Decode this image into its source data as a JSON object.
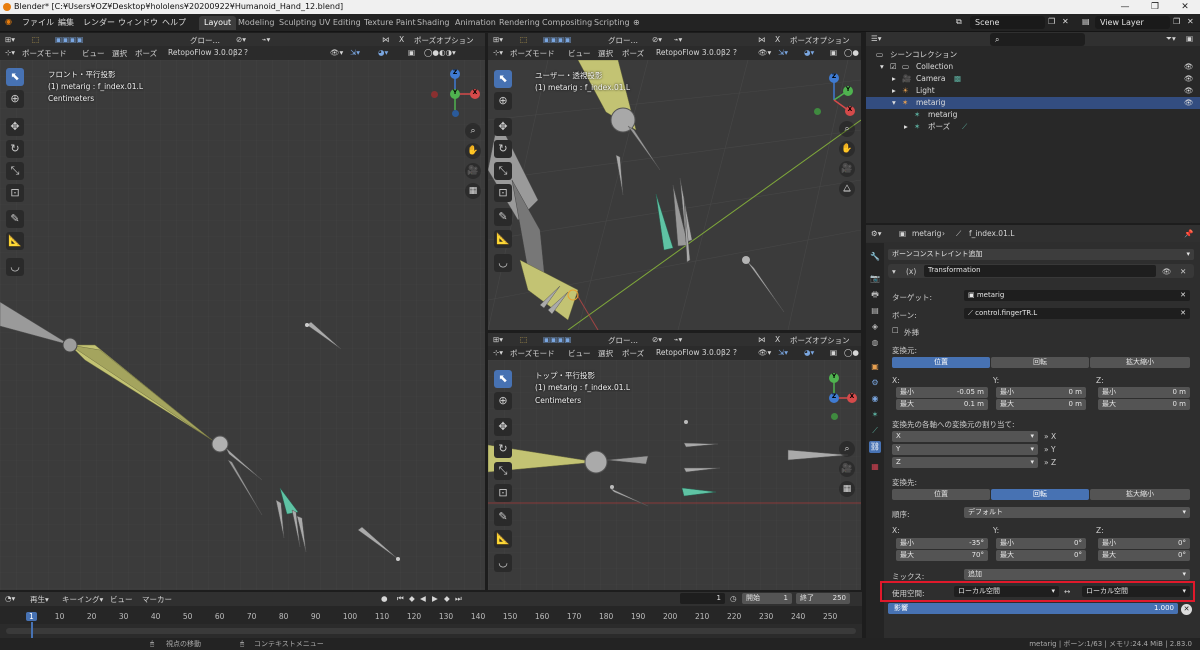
{
  "window": {
    "title": "Blender* [C:¥Users¥OZ¥Desktop¥hololens¥20200922¥Humanoid_Hand_12.blend]"
  },
  "menu": [
    "ファイル",
    "編集",
    "レンダー",
    "ウィンドウ",
    "ヘルプ"
  ],
  "workspaces": [
    "Layout",
    "Modeling",
    "Sculpting",
    "UV Editing",
    "Texture Paint",
    "Shading",
    "Animation",
    "Rendering",
    "Compositing",
    "Scripting"
  ],
  "active_workspace": "Layout",
  "scene_name": "Scene",
  "view_layer": "View Layer",
  "viewport_header": {
    "mode": "ポーズモード",
    "view": "ビュー",
    "select": "選択",
    "pose": "ポーズ",
    "addon": "RetopoFlow 3.0.0β2",
    "pose_options": "ポーズオプション",
    "orientation": "グロー…",
    "x_mirror": "X"
  },
  "viewports": {
    "front": {
      "view_name": "フロント・平行投影",
      "object": "(1) metarig : f_index.01.L",
      "units": "Centimeters"
    },
    "user": {
      "view_name": "ユーザー・透視投影",
      "object": "(1) metarig : f_index.01.L"
    },
    "top": {
      "view_name": "トップ・平行投影",
      "object": "(1) metarig : f_index.01.L",
      "units": "Centimeters"
    }
  },
  "outliner": {
    "header": "シーンコレクション",
    "rows": [
      "Collection",
      "Camera",
      "Light",
      "metarig",
      "metarig",
      "ポーズ"
    ],
    "search_placeholder": ""
  },
  "properties": {
    "breadcrumb_object": "metarig",
    "breadcrumb_bone": "f_index.01.L",
    "add_constraint": "ボーンコンストレイント追加",
    "constraint_name": "Transformation",
    "target_label": "ターゲット:",
    "target_value": "metarig",
    "bone_label": "ボーン:",
    "bone_value": "control.fingerTR.L",
    "extrapolate_label": "外挿",
    "map_from_label": "変換元:",
    "map_from_tabs": [
      "位置",
      "回転",
      "拡大縮小"
    ],
    "axis_x": "X:",
    "axis_y": "Y:",
    "axis_z": "Z:",
    "min_label": "最小",
    "max_label": "最大",
    "from_x_min": "-0.05 m",
    "from_x_max": "0.1 m",
    "from_y_min": "0 m",
    "from_y_max": "0 m",
    "from_z_min": "0 m",
    "from_z_max": "0 m",
    "mapping_label": "変換先の各軸への変換元の割り当て:",
    "mapping_rows": [
      {
        "source": "X",
        "target": "X"
      },
      {
        "source": "Y",
        "target": "Y"
      },
      {
        "source": "Z",
        "target": "Z"
      }
    ],
    "map_to_label": "変換先:",
    "map_to_tabs": [
      "位置",
      "回転",
      "拡大縮小"
    ],
    "order_label": "順序:",
    "order_value": "デフォルト",
    "to_x_min": "-35°",
    "to_x_max": "70°",
    "to_y_min": "0°",
    "to_y_max": "0°",
    "to_z_min": "0°",
    "to_z_max": "0°",
    "mix_label": "ミックス:",
    "mix_value": "追加",
    "space_label": "使用空間:",
    "owner_space": "ローカル空間",
    "target_space": "ローカル空間",
    "influence_label": "影響",
    "influence_value": "1.000",
    "influence_fraction": 1.0
  },
  "timeline": {
    "playback": "再生",
    "keying": "キーイング",
    "view": "ビュー",
    "marker": "マーカー",
    "current_frame": "1",
    "start_label": "開始",
    "start_value": "1",
    "end_label": "終了",
    "end_value": "250",
    "ticks": [
      "1",
      "10",
      "20",
      "30",
      "40",
      "50",
      "60",
      "70",
      "80",
      "90",
      "100",
      "110",
      "120",
      "130",
      "140",
      "150",
      "160",
      "170",
      "180",
      "190",
      "200",
      "210",
      "220",
      "230",
      "240",
      "250"
    ]
  },
  "status": {
    "left": "視点の移動",
    "middle": "コンテキストメニュー",
    "right": "metarig | ボーン:1/63 | メモリ:24.4 MiB | 2.83.0"
  }
}
